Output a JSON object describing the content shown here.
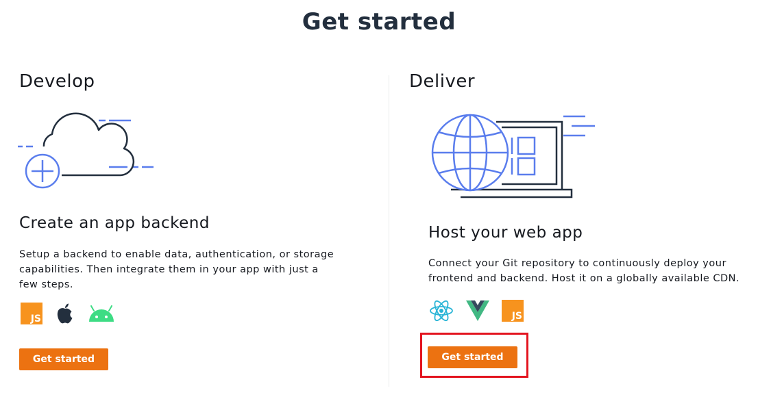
{
  "page": {
    "title": "Get started"
  },
  "develop": {
    "heading": "Develop",
    "card_title": "Create an app backend",
    "description_line1": "Setup a backend to enable data, authentication, or storage",
    "description_line2": "capabilities. Then integrate them in your app with just a",
    "description_line3": "few steps.",
    "platform_icons": [
      "javascript-icon",
      "apple-icon",
      "android-icon"
    ],
    "js_label": "JS",
    "button_label": "Get started"
  },
  "deliver": {
    "heading": "Deliver",
    "card_title": "Host your web app",
    "description_line1": "Connect your Git repository to continuously deploy your",
    "description_line2": "frontend and backend. Host it on a globally available CDN.",
    "framework_icons": [
      "react-icon",
      "vue-icon",
      "javascript-icon"
    ],
    "js_label": "JS",
    "button_label": "Get started"
  },
  "colors": {
    "accent_button": "#ec7211",
    "illustration_blue": "#5a7ded",
    "illustration_dark": "#232f3e",
    "highlight_red": "#e3141f",
    "js_orange": "#f7931e",
    "android_green": "#3ddc84",
    "react_blue": "#28b4d6",
    "vue_green": "#41b883",
    "vue_dark": "#35495e"
  }
}
